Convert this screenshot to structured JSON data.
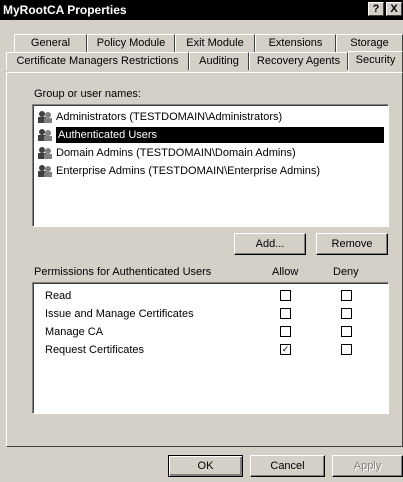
{
  "window": {
    "title": "MyRootCA Properties",
    "help_glyph": "?",
    "close_glyph": "X"
  },
  "tabs": {
    "row_top": [
      "General",
      "Policy Module",
      "Exit Module",
      "Extensions",
      "Storage"
    ],
    "row_bottom": [
      "Certificate Managers Restrictions",
      "Auditing",
      "Recovery Agents",
      "Security"
    ],
    "active": "Security"
  },
  "users_section": {
    "label": "Group or user names:",
    "items": [
      {
        "label": "Administrators (TESTDOMAIN\\Administrators)",
        "selected": false
      },
      {
        "label": "Authenticated Users",
        "selected": true
      },
      {
        "label": "Domain Admins (TESTDOMAIN\\Domain Admins)",
        "selected": false
      },
      {
        "label": "Enterprise Admins (TESTDOMAIN\\Enterprise Admins)",
        "selected": false
      }
    ],
    "add_label": "Add...",
    "remove_label": "Remove"
  },
  "permissions": {
    "header": "Permissions for Authenticated Users",
    "allow_header": "Allow",
    "deny_header": "Deny",
    "checked_glyph": "✓",
    "rows": [
      {
        "label": "Read",
        "allow": false,
        "deny": false
      },
      {
        "label": "Issue and Manage Certificates",
        "allow": false,
        "deny": false
      },
      {
        "label": "Manage CA",
        "allow": false,
        "deny": false
      },
      {
        "label": "Request Certificates",
        "allow": true,
        "deny": false
      }
    ]
  },
  "footer": {
    "ok_label": "OK",
    "cancel_label": "Cancel",
    "apply_label": "Apply"
  },
  "colors": {
    "dialog_bg": "#d4d0c8",
    "titlebar_bg": "#000000",
    "selection_bg": "#000000",
    "disabled_text": "#808080"
  },
  "icons": {
    "user_group": "users-group-icon",
    "check": "checkmark-icon"
  }
}
